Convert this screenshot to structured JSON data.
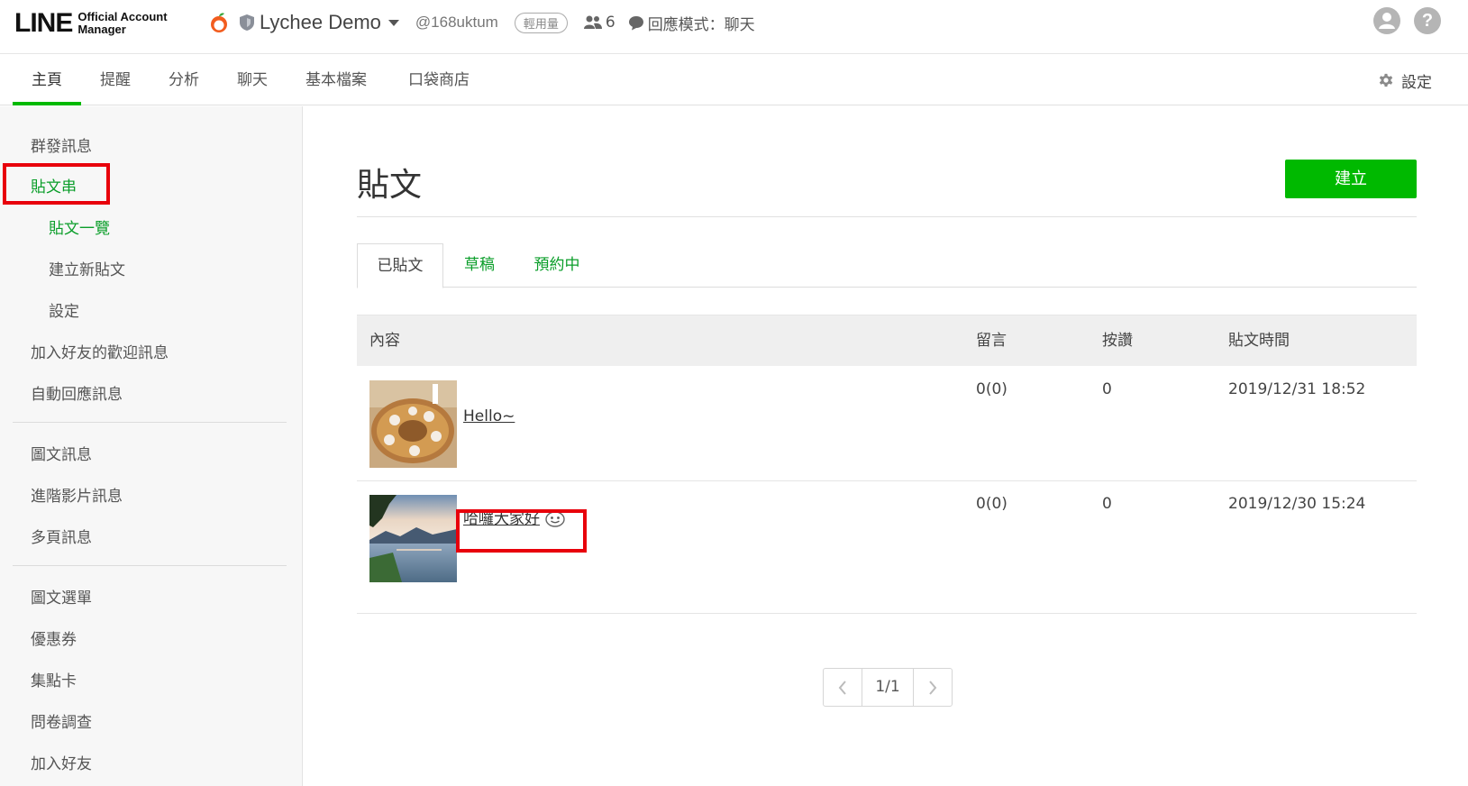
{
  "header": {
    "logo_main": "LINE",
    "logo_sub_1": "Official Account",
    "logo_sub_2": "Manager",
    "account_name": "Lychee Demo",
    "account_id": "@168uktum",
    "plan_badge": "輕用量",
    "friends_count": "6",
    "reply_mode": "回應模式：聊天",
    "help_label": "?"
  },
  "nav": {
    "items": [
      {
        "label": "主頁"
      },
      {
        "label": "提醒"
      },
      {
        "label": "分析"
      },
      {
        "label": "聊天"
      },
      {
        "label": "基本檔案"
      },
      {
        "label": "口袋商店"
      }
    ],
    "active": "主頁",
    "settings_label": "設定"
  },
  "sidebar": {
    "items": [
      {
        "label": "群發訊息"
      },
      {
        "label": "貼文串"
      },
      {
        "label": "貼文一覽"
      },
      {
        "label": "建立新貼文"
      },
      {
        "label": "設定"
      },
      {
        "label": "加入好友的歡迎訊息"
      },
      {
        "label": "自動回應訊息"
      },
      {
        "label": "圖文訊息"
      },
      {
        "label": "進階影片訊息"
      },
      {
        "label": "多頁訊息"
      },
      {
        "label": "圖文選單"
      },
      {
        "label": "優惠券"
      },
      {
        "label": "集點卡"
      },
      {
        "label": "問卷調查"
      },
      {
        "label": "加入好友"
      }
    ]
  },
  "main": {
    "title": "貼文",
    "create_label": "建立",
    "tabs": [
      {
        "label": "已貼文"
      },
      {
        "label": "草稿"
      },
      {
        "label": "預約中"
      }
    ],
    "active_tab": "已貼文",
    "table": {
      "headers": [
        "內容",
        "留言",
        "按讚",
        "貼文時間"
      ],
      "rows": [
        {
          "content": "Hello~",
          "comments": "0(0)",
          "likes": "0",
          "time": "2019/12/31 18:52"
        },
        {
          "content": "哈囉大家好",
          "comments": "0(0)",
          "likes": "0",
          "time": "2019/12/30 15:24"
        }
      ]
    },
    "pagination": "1/1"
  },
  "colors": {
    "accent": "#00b900",
    "accent_text": "#0b9e2a",
    "highlight": "#e8000b"
  }
}
